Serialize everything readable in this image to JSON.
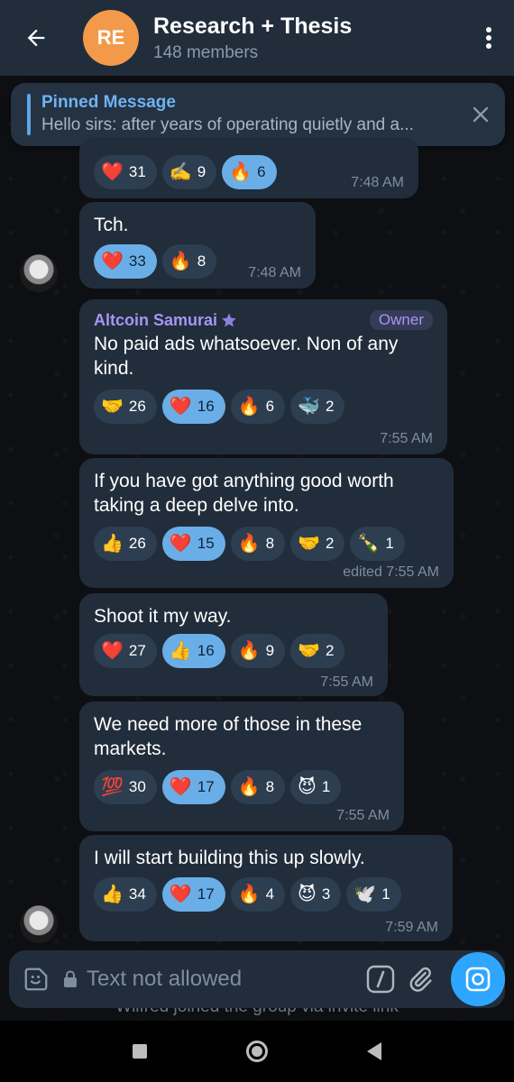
{
  "header": {
    "avatar_initials": "RE",
    "title": "Research + Thesis",
    "subtitle": "148 members"
  },
  "pinned": {
    "title": "Pinned Message",
    "text": "Hello sirs: after years of operating quietly and a..."
  },
  "messages": [
    {
      "reactions": [
        {
          "emoji": "❤️",
          "count": "31",
          "mine": false
        },
        {
          "emoji": "✍️",
          "count": "9",
          "mine": false
        },
        {
          "emoji": "🔥",
          "count": "6",
          "mine": true
        }
      ],
      "time": "7:48 AM"
    },
    {
      "text": "Tch.",
      "reactions": [
        {
          "emoji": "❤️",
          "count": "33",
          "mine": true
        },
        {
          "emoji": "🔥",
          "count": "8",
          "mine": false
        }
      ],
      "time": "7:48 AM"
    },
    {
      "sender": "Altcoin Samurai",
      "badge": "Owner",
      "text": "No paid ads whatsoever. Non of any kind.",
      "reactions": [
        {
          "emoji": "🤝",
          "count": "26",
          "mine": false
        },
        {
          "emoji": "❤️",
          "count": "16",
          "mine": true
        },
        {
          "emoji": "🔥",
          "count": "6",
          "mine": false
        },
        {
          "emoji": "🐳",
          "count": "2",
          "mine": false
        }
      ],
      "time": "7:55 AM"
    },
    {
      "text": "If you have got anything good worth taking a deep delve into.",
      "reactions": [
        {
          "emoji": "👍",
          "count": "26",
          "mine": false
        },
        {
          "emoji": "❤️",
          "count": "15",
          "mine": true
        },
        {
          "emoji": "🔥",
          "count": "8",
          "mine": false
        },
        {
          "emoji": "🤝",
          "count": "2",
          "mine": false
        },
        {
          "emoji": "🍾",
          "count": "1",
          "mine": false
        }
      ],
      "time": "edited 7:55 AM"
    },
    {
      "text": "Shoot it my way.",
      "reactions": [
        {
          "emoji": "❤️",
          "count": "27",
          "mine": false
        },
        {
          "emoji": "👍",
          "count": "16",
          "mine": true
        },
        {
          "emoji": "🔥",
          "count": "9",
          "mine": false
        },
        {
          "emoji": "🤝",
          "count": "2",
          "mine": false
        }
      ],
      "time": "7:55 AM"
    },
    {
      "text": "We need more of those in these markets.",
      "reactions": [
        {
          "emoji": "💯",
          "count": "30",
          "mine": false
        },
        {
          "emoji": "❤️",
          "count": "17",
          "mine": true
        },
        {
          "emoji": "🔥",
          "count": "8",
          "mine": false
        },
        {
          "emoji": "😈",
          "count": "1",
          "mine": false
        }
      ],
      "time": "7:55 AM"
    },
    {
      "text": "I will start building this up slowly.",
      "reactions": [
        {
          "emoji": "👍",
          "count": "34",
          "mine": false
        },
        {
          "emoji": "❤️",
          "count": "17",
          "mine": true
        },
        {
          "emoji": "🔥",
          "count": "4",
          "mine": false
        },
        {
          "emoji": "😈",
          "count": "3",
          "mine": false
        },
        {
          "emoji": "🕊️",
          "count": "1",
          "mine": false
        }
      ],
      "time": "7:59 AM"
    }
  ],
  "input": {
    "placeholder": "Text not allowed"
  },
  "service_note": "Wilfred joined the group via invite link",
  "colors": {
    "header_bg": "#212d3b",
    "bubble_bg": "#212d3b",
    "accent": "#2ea6ff",
    "mine_chip": "#6aaee8",
    "owner": "#a795f5",
    "avatar_re": "#f29a4a"
  },
  "icons": {
    "back": "arrow-left-icon",
    "more": "more-vertical-icon",
    "close": "close-icon",
    "sticker": "sticker-icon",
    "lock": "lock-icon",
    "command": "slash-command-icon",
    "attach": "paperclip-icon",
    "camera": "camera-icon"
  }
}
